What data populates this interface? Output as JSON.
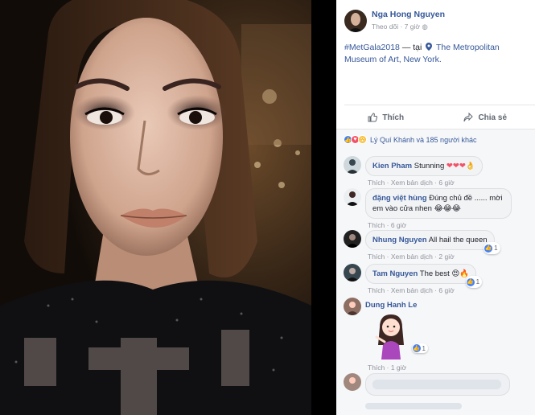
{
  "post": {
    "author": "Nga Hong Nguyen",
    "follow": "Theo dõi",
    "time": "7 giờ",
    "hashtag": "#MetGala2018",
    "at": "— tại",
    "place": "The Metropolitan Museum of Art, New York."
  },
  "actions": {
    "like": "Thích",
    "share": "Chia sẻ"
  },
  "reactions": {
    "summary": "Lý Quí Khánh và 185 người khác"
  },
  "comments": [
    {
      "name": "Kien Pham",
      "text": "Stunning",
      "emoji": "❤❤❤👌",
      "like": "Thích",
      "translate": "Xem bản dịch",
      "time": "6 giờ"
    },
    {
      "name": "đặng việt hùng",
      "text": "Đúng chủ đề ...... mời em vào cửa nhen",
      "emoji": "😂😂😂",
      "like": "Thích",
      "time": "6 giờ"
    },
    {
      "name": "Nhung Nguyen",
      "text": "All hail the queen",
      "like": "Thích",
      "translate": "Xem bản dịch",
      "time": "2 giờ",
      "react_count": "1"
    },
    {
      "name": "Tam Nguyen",
      "text": "The best",
      "emoji": "😍🔥",
      "like": "Thích",
      "translate": "Xem bản dịch",
      "time": "6 giờ",
      "react_count": "1"
    },
    {
      "name": "Dung Hanh Le",
      "like": "Thích",
      "time": "1 giờ",
      "react_count": "1",
      "sticker": "girl-sticker"
    }
  ],
  "colors": {
    "link": "#365899",
    "like_blue": "#4080ff",
    "heart_red": "#f25268"
  }
}
